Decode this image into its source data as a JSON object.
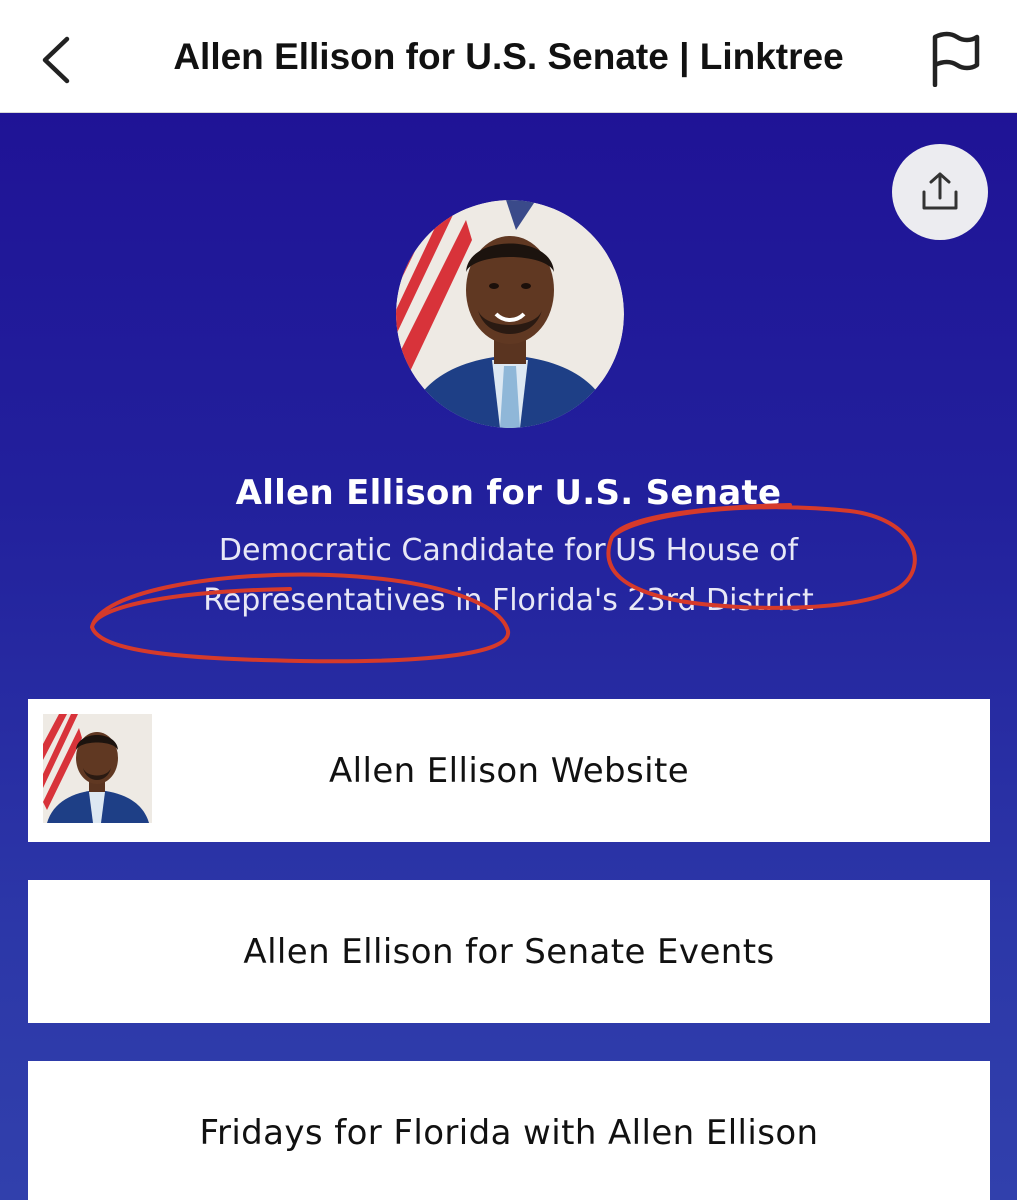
{
  "header": {
    "title": "Allen Ellison for U.S. Senate | Linktree",
    "back_icon": "chevron-left-icon",
    "report_icon": "flag-icon"
  },
  "profile": {
    "name": "Allen Ellison for U.S. Senate",
    "bio": "Democratic Candidate for US House of Representatives in Florida's 23rd District"
  },
  "share": {
    "icon": "share-icon"
  },
  "links": [
    {
      "label": "Allen Ellison Website",
      "has_thumbnail": true
    },
    {
      "label": "Allen Ellison for Senate Events",
      "has_thumbnail": false
    },
    {
      "label": "Fridays for Florida with Allen Ellison",
      "has_thumbnail": false
    }
  ],
  "colors": {
    "background_top": "#1f1396",
    "background_bottom": "#3140ac",
    "card": "#ffffff",
    "annotation": "#d63a2a"
  }
}
